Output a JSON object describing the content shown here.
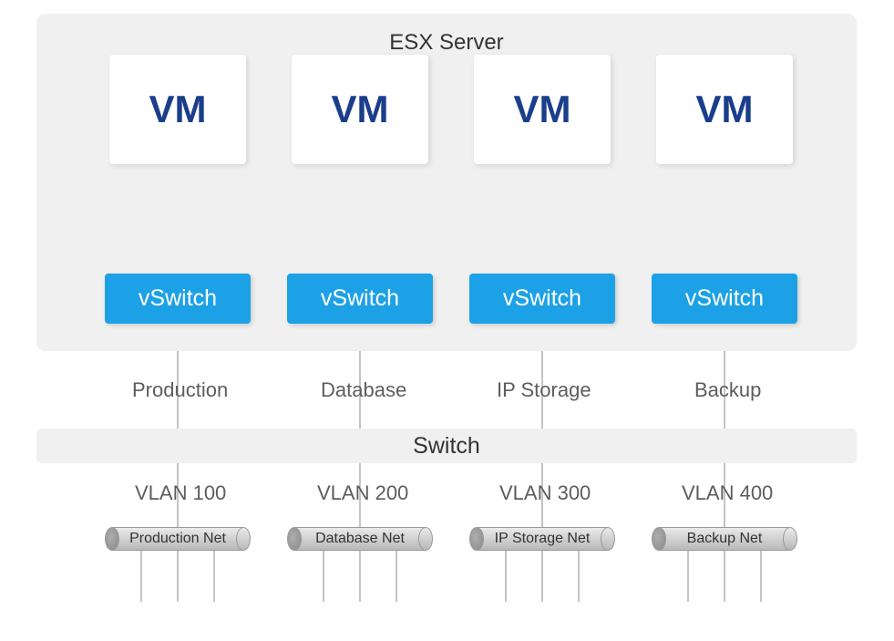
{
  "esx": {
    "title": "ESX Server"
  },
  "vms": [
    {
      "label": "VM"
    },
    {
      "label": "VM"
    },
    {
      "label": "VM"
    },
    {
      "label": "VM"
    }
  ],
  "vswitches": [
    {
      "label": "vSwitch",
      "netlabel": "Production"
    },
    {
      "label": "vSwitch",
      "netlabel": "Database"
    },
    {
      "label": "vSwitch",
      "netlabel": "IP Storage"
    },
    {
      "label": "vSwitch",
      "netlabel": "Backup"
    }
  ],
  "switch": {
    "label": "Switch"
  },
  "vlans": [
    {
      "label": "VLAN 100",
      "net": "Production Net"
    },
    {
      "label": "VLAN 200",
      "net": "Database Net"
    },
    {
      "label": "VLAN 300",
      "net": "IP Storage Net"
    },
    {
      "label": "VLAN 400",
      "net": "Backup Net"
    }
  ]
}
